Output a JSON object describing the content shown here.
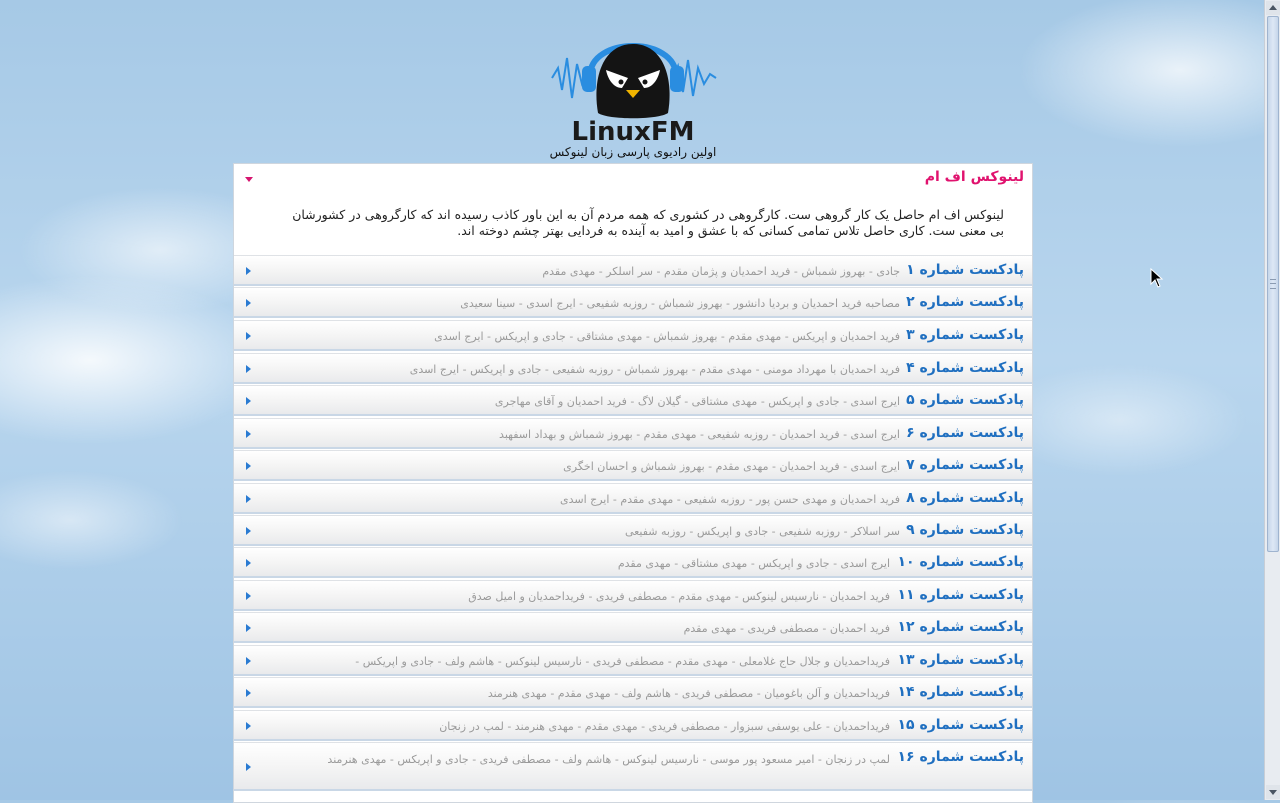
{
  "header": {
    "logo_text": "LinuxFM",
    "tagline": "اولین رادیوی  پارسی زبان لینوکس"
  },
  "about": {
    "title": "لینوکس اف ام",
    "body": "لینوکس اف ام حاصل یک کار گروهی ست. کارگروهی در کشوری که همه مردم آن به این باور کاذب رسیده اند که کارگروهی در کشورشان بی معنی ست. کاری حاصل تلاس تمامی کسانی که با عشق و امید به آینده به فردایی بهتر چشم دوخته اند."
  },
  "podcasts": [
    {
      "title": "پادکست شماره ۱",
      "desc": "جادی - بهروز شمباش - فرید احمدیان و پژمان مقدم - سر اسلکر - مهدی مقدم"
    },
    {
      "title": "پادکست شماره ۲",
      "desc": "مصاحبه فرید احمدیان و بردیا دانشور - بهروز شمباش - روزبه شفیعی - ایرج اسدی - سینا سعیدی"
    },
    {
      "title": "پادکست شماره ۳",
      "desc": "فرید احمدیان و اپریکس - مهدی مقدم - بهروز شمباش - مهدی مشتاقی - جادی و اپریکس - ایرج اسدی"
    },
    {
      "title": "پادکست شماره ۴",
      "desc": "فرید احمدیان با مهرداد مومنی - مهدی مقدم - بهروز شمباش - روزبه شفیعی - جادی و اپریکس - ایرج اسدی"
    },
    {
      "title": "پادکست شماره ۵",
      "desc": "ایرج اسدی - جادی و اپریکس - مهدی مشتاقی - گیلان لاگ - فرید احمدیان و آقای مهاجری"
    },
    {
      "title": "پادکست شماره ۶",
      "desc": "ایرج اسدی - فرید احمدیان - روزبه شفیعی - مهدی مقدم - بهروز شمباش و بهداد اسفهبد"
    },
    {
      "title": "پادکست شماره ۷",
      "desc": "ایرج اسدی - فرید احمدیان - مهدی مقدم - بهروز شمباش و احسان اخگری"
    },
    {
      "title": "پادکست شماره ۸",
      "desc": "فرید احمدیان و مهدی حسن پور - روزبه شفیعی - مهدی مقدم - ایرج اسدی"
    },
    {
      "title": "پادکست شماره ۹",
      "desc": "سر اسلاکر - روزبه شفیعی - جادی و اپریکس - روزبه شفیعی"
    },
    {
      "title": "پادکست شماره ۱۰",
      "desc": "ایرج اسدی - جادی و اپریکس - مهدی مشتاقی - مهدی مقدم"
    },
    {
      "title": "پادکست شماره ۱۱",
      "desc": "فرید احمدیان - نارسیس لینوکس - مهدی مقدم - مصطفی فریدی - فریداحمدیان و امیل صدق"
    },
    {
      "title": "پادکست شماره ۱۲",
      "desc": "فرید احمدیان - مصطفی فریدی - مهدی مقدم"
    },
    {
      "title": "پادکست شماره ۱۳",
      "desc": "فریداحمدیان و جلال حاج غلامعلی - مهدی مقدم - مصطفی فریدی - نارسیس لینوکس - هاشم ولف - جادی و اپریکس -"
    },
    {
      "title": "پادکست شماره ۱۴",
      "desc": "فریداحمدیان و آلن باغومیان - مصطفی فریدی - هاشم ولف - مهدی مقدم - مهدی هنرمند"
    },
    {
      "title": "پادکست شماره ۱۵",
      "desc": "فریداحمدیان - علی یوسفی سبزوار - مصطفی فریدی - مهدی مقدم - مهدی هنرمند - لمپ در زنجان"
    },
    {
      "title": "پادکست شماره ۱۶",
      "desc": "لمپ در زنجان - امیر مسعود پور موسی - نارسیس لینوکس - هاشم ولف - مصطفی فریدی - جادی و اپریکس - مهدی هنرمند"
    }
  ],
  "colors": {
    "title_blue": "#1f6fc0",
    "about_pink": "#e0126e",
    "desc_gray": "#9a9a9a"
  }
}
